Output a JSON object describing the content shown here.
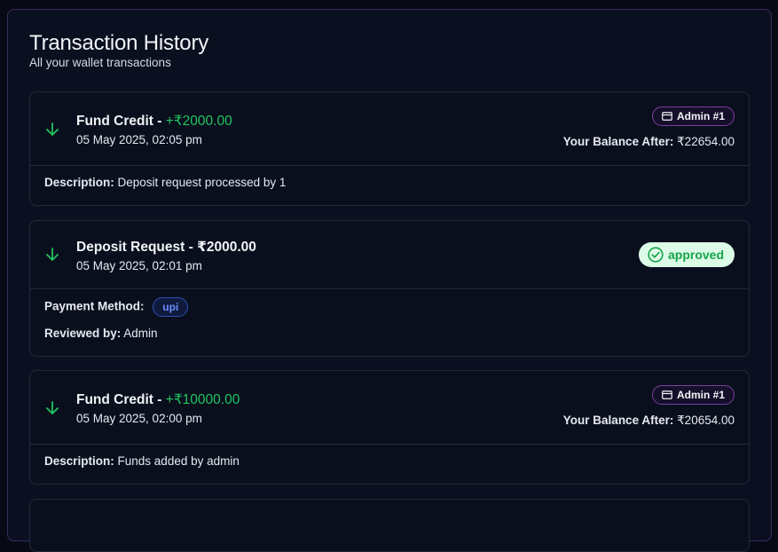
{
  "header": {
    "title": "Transaction History",
    "subtitle": "All your wallet transactions"
  },
  "transactions": [
    {
      "title_prefix": "Fund Credit - ",
      "amount": "+₹2000.00",
      "date": "05 May 2025, 02:05 pm",
      "admin_badge": "Admin #1",
      "balance_label": "Your Balance After:",
      "balance_value": "₹22654.00",
      "description_label": "Description:",
      "description_value": "Deposit request processed by 1"
    },
    {
      "title": "Deposit Request - ₹2000.00",
      "date": "05 May 2025, 02:01 pm",
      "status": "approved",
      "payment_method_label": "Payment Method:",
      "payment_method_value": "upi",
      "reviewed_by_label": "Reviewed by:",
      "reviewed_by_value": "Admin"
    },
    {
      "title_prefix": "Fund Credit - ",
      "amount": "+₹10000.00",
      "date": "05 May 2025, 02:00 pm",
      "admin_badge": "Admin #1",
      "balance_label": "Your Balance After:",
      "balance_value": "₹20654.00",
      "description_label": "Description:",
      "description_value": "Funds added by admin"
    }
  ],
  "colors": {
    "accent_green": "#22c55e",
    "approved_bg": "#dcfce7",
    "admin_border": "#7a3f9e",
    "upi_text": "#6a8cff"
  },
  "icons": {
    "credit": "arrow-down-icon",
    "admin": "card-icon",
    "approved": "check-circle-icon"
  }
}
